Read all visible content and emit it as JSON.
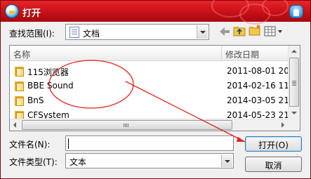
{
  "window": {
    "title": "打开"
  },
  "lookin": {
    "label": "查找范围(I):",
    "value": "文档"
  },
  "columns": {
    "name": "名称",
    "modified": "修改日期"
  },
  "files": [
    {
      "name": "115浏览器",
      "modified": "2011-08-01 20:5"
    },
    {
      "name": "BBE Sound",
      "modified": "2014-02-16 11:5"
    },
    {
      "name": "BnS",
      "modified": "2014-03-05 21:3"
    },
    {
      "name": "CFSystem",
      "modified": "2014-05-23 21:3"
    }
  ],
  "filename": {
    "label": "文件名(N):",
    "value": ""
  },
  "filetype": {
    "label": "文件类型(T):",
    "value": "文本"
  },
  "buttons": {
    "open": "打开(O)",
    "cancel": "取消"
  },
  "annotation": {
    "color": "#e0201c"
  },
  "icons": {
    "back": "back-arrow-icon",
    "up": "up-folder-icon",
    "new_folder": "new-folder-icon",
    "view": "view-menu-icon"
  }
}
